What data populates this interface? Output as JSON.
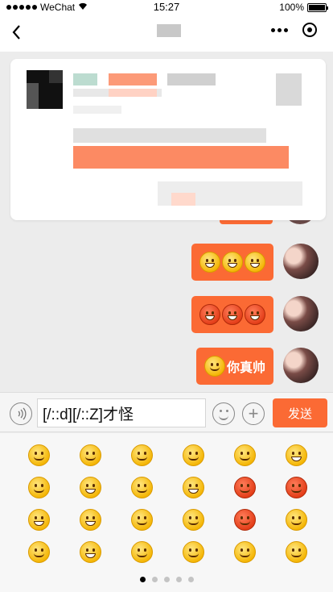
{
  "status_bar": {
    "carrier": "WeChat",
    "time": "15:27",
    "battery": "100%",
    "battery_level": 1.0
  },
  "nav": {
    "title": ""
  },
  "messages": [
    {
      "id": "m1",
      "text": "",
      "emoji": [
        "grin",
        "grin",
        "grin"
      ]
    },
    {
      "id": "m2",
      "text": "",
      "emoji": [
        "angry",
        "angry",
        "angry"
      ]
    },
    {
      "id": "m3",
      "text": "你真帅",
      "emoji": [
        "smile"
      ]
    }
  ],
  "input": {
    "value": "[/::d][/::Z]才怪",
    "send_label": "发送",
    "voice_icon": "voice-icon",
    "emoji_icon": "smiley-icon",
    "plus_icon": "plus-icon"
  },
  "emoji_panel": {
    "emoji": [
      "smile",
      "awkward",
      "heart-eyes",
      "surprised",
      "cool",
      "crying",
      "shy",
      "shut-mouth",
      "sleepy",
      "cry",
      "angry-red",
      "furious",
      "tongue",
      "grin",
      "surprised-eyes",
      "sad",
      "cool-angry",
      "blush",
      "vomit",
      "giggle",
      "thinking",
      "smirk",
      "shock",
      "wipe-sweat"
    ],
    "pages": 5,
    "current_page": 1
  },
  "colors": {
    "accent": "#fb6a34",
    "background": "#ececec"
  }
}
